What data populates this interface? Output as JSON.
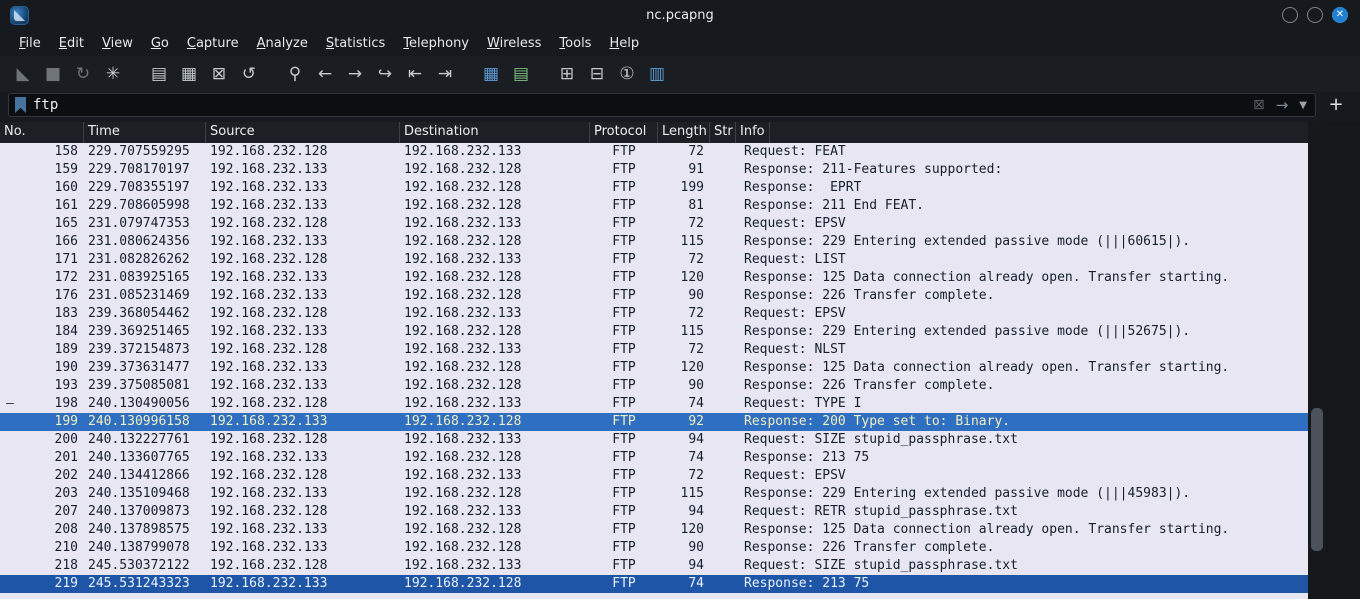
{
  "window": {
    "title": "nc.pcapng",
    "controls": [
      {
        "name": "minimize-button",
        "glyph": ""
      },
      {
        "name": "maximize-button",
        "glyph": ""
      },
      {
        "name": "close-button",
        "glyph": "✕",
        "state": "close"
      }
    ]
  },
  "menu": {
    "items": [
      "File",
      "Edit",
      "View",
      "Go",
      "Capture",
      "Analyze",
      "Statistics",
      "Telephony",
      "Wireless",
      "Tools",
      "Help"
    ]
  },
  "toolbar": {
    "icons": [
      {
        "name": "capture-start-icon",
        "glyph": "◣",
        "state": "disabled"
      },
      {
        "name": "capture-stop-icon",
        "glyph": "■",
        "state": "disabled"
      },
      {
        "name": "capture-restart-icon",
        "glyph": "↻",
        "state": "disabled"
      },
      {
        "name": "capture-options-icon",
        "glyph": "✳"
      },
      {
        "name": "file-open-icon",
        "glyph": "▤",
        "state": "gap"
      },
      {
        "name": "file-save-icon",
        "glyph": "▦"
      },
      {
        "name": "file-close-icon",
        "glyph": "⊠"
      },
      {
        "name": "reload-icon",
        "glyph": "↺"
      },
      {
        "name": "find-packet-icon",
        "glyph": "⚲",
        "state": "gap"
      },
      {
        "name": "go-back-icon",
        "glyph": "←"
      },
      {
        "name": "go-forward-icon",
        "glyph": "→"
      },
      {
        "name": "go-to-packet-icon",
        "glyph": "↪"
      },
      {
        "name": "go-first-packet-icon",
        "glyph": "⇤"
      },
      {
        "name": "go-last-packet-icon",
        "glyph": "⇥"
      },
      {
        "name": "colorize-icon",
        "glyph": "▦",
        "state": "blue gap"
      },
      {
        "name": "auto-scroll-icon",
        "glyph": "▤",
        "state": "green"
      },
      {
        "name": "zoom-in-icon",
        "glyph": "⊞",
        "state": "gap"
      },
      {
        "name": "zoom-out-icon",
        "glyph": "⊟"
      },
      {
        "name": "zoom-original-icon",
        "glyph": "①"
      },
      {
        "name": "resize-columns-icon",
        "glyph": "▥",
        "state": "blue"
      }
    ]
  },
  "filter": {
    "value": "ftp",
    "add_button": "+"
  },
  "table": {
    "columns": [
      "No.",
      "Time",
      "Source",
      "Destination",
      "Protocol",
      "Length",
      "Str",
      "Info"
    ],
    "rows": [
      {
        "no": "158",
        "time": "229.707559295",
        "src": "192.168.232.128",
        "dst": "192.168.232.133",
        "proto": "FTP",
        "len": "72",
        "info": "Request: FEAT"
      },
      {
        "no": "159",
        "time": "229.708170197",
        "src": "192.168.232.133",
        "dst": "192.168.232.128",
        "proto": "FTP",
        "len": "91",
        "info": "Response: 211-Features supported:"
      },
      {
        "no": "160",
        "time": "229.708355197",
        "src": "192.168.232.133",
        "dst": "192.168.232.128",
        "proto": "FTP",
        "len": "199",
        "info": "Response:  EPRT"
      },
      {
        "no": "161",
        "time": "229.708605998",
        "src": "192.168.232.133",
        "dst": "192.168.232.128",
        "proto": "FTP",
        "len": "81",
        "info": "Response: 211 End FEAT."
      },
      {
        "no": "165",
        "time": "231.079747353",
        "src": "192.168.232.128",
        "dst": "192.168.232.133",
        "proto": "FTP",
        "len": "72",
        "info": "Request: EPSV"
      },
      {
        "no": "166",
        "time": "231.080624356",
        "src": "192.168.232.133",
        "dst": "192.168.232.128",
        "proto": "FTP",
        "len": "115",
        "info": "Response: 229 Entering extended passive mode (|||60615|)."
      },
      {
        "no": "171",
        "time": "231.082826262",
        "src": "192.168.232.128",
        "dst": "192.168.232.133",
        "proto": "FTP",
        "len": "72",
        "info": "Request: LIST"
      },
      {
        "no": "172",
        "time": "231.083925165",
        "src": "192.168.232.133",
        "dst": "192.168.232.128",
        "proto": "FTP",
        "len": "120",
        "info": "Response: 125 Data connection already open. Transfer starting."
      },
      {
        "no": "176",
        "time": "231.085231469",
        "src": "192.168.232.133",
        "dst": "192.168.232.128",
        "proto": "FTP",
        "len": "90",
        "info": "Response: 226 Transfer complete."
      },
      {
        "no": "183",
        "time": "239.368054462",
        "src": "192.168.232.128",
        "dst": "192.168.232.133",
        "proto": "FTP",
        "len": "72",
        "info": "Request: EPSV"
      },
      {
        "no": "184",
        "time": "239.369251465",
        "src": "192.168.232.133",
        "dst": "192.168.232.128",
        "proto": "FTP",
        "len": "115",
        "info": "Response: 229 Entering extended passive mode (|||52675|)."
      },
      {
        "no": "189",
        "time": "239.372154873",
        "src": "192.168.232.128",
        "dst": "192.168.232.133",
        "proto": "FTP",
        "len": "72",
        "info": "Request: NLST"
      },
      {
        "no": "190",
        "time": "239.373631477",
        "src": "192.168.232.133",
        "dst": "192.168.232.128",
        "proto": "FTP",
        "len": "120",
        "info": "Response: 125 Data connection already open. Transfer starting."
      },
      {
        "no": "193",
        "time": "239.375085081",
        "src": "192.168.232.133",
        "dst": "192.168.232.128",
        "proto": "FTP",
        "len": "90",
        "info": "Response: 226 Transfer complete."
      },
      {
        "no": "198",
        "time": "240.130490056",
        "src": "192.168.232.128",
        "dst": "192.168.232.133",
        "proto": "FTP",
        "len": "74",
        "info": "Request: TYPE I",
        "marker": "–"
      },
      {
        "no": "199",
        "time": "240.130996158",
        "src": "192.168.232.133",
        "dst": "192.168.232.128",
        "proto": "FTP",
        "len": "92",
        "info": "Response: 200 Type set to: Binary.",
        "state": "selected"
      },
      {
        "no": "200",
        "time": "240.132227761",
        "src": "192.168.232.128",
        "dst": "192.168.232.133",
        "proto": "FTP",
        "len": "94",
        "info": "Request: SIZE stupid_passphrase.txt"
      },
      {
        "no": "201",
        "time": "240.133607765",
        "src": "192.168.232.133",
        "dst": "192.168.232.128",
        "proto": "FTP",
        "len": "74",
        "info": "Response: 213 75"
      },
      {
        "no": "202",
        "time": "240.134412866",
        "src": "192.168.232.128",
        "dst": "192.168.232.133",
        "proto": "FTP",
        "len": "72",
        "info": "Request: EPSV"
      },
      {
        "no": "203",
        "time": "240.135109468",
        "src": "192.168.232.133",
        "dst": "192.168.232.128",
        "proto": "FTP",
        "len": "115",
        "info": "Response: 229 Entering extended passive mode (|||45983|)."
      },
      {
        "no": "207",
        "time": "240.137009873",
        "src": "192.168.232.128",
        "dst": "192.168.232.133",
        "proto": "FTP",
        "len": "94",
        "info": "Request: RETR stupid_passphrase.txt"
      },
      {
        "no": "208",
        "time": "240.137898575",
        "src": "192.168.232.133",
        "dst": "192.168.232.128",
        "proto": "FTP",
        "len": "120",
        "info": "Response: 125 Data connection already open. Transfer starting."
      },
      {
        "no": "210",
        "time": "240.138799078",
        "src": "192.168.232.133",
        "dst": "192.168.232.128",
        "proto": "FTP",
        "len": "90",
        "info": "Response: 226 Transfer complete."
      },
      {
        "no": "218",
        "time": "245.530372122",
        "src": "192.168.232.128",
        "dst": "192.168.232.133",
        "proto": "FTP",
        "len": "94",
        "info": "Request: SIZE stupid_passphrase.txt"
      },
      {
        "no": "219",
        "time": "245.531243323",
        "src": "192.168.232.133",
        "dst": "192.168.232.128",
        "proto": "FTP",
        "len": "74",
        "info": "Response: 213 75",
        "state": "selected-dark"
      }
    ]
  },
  "colors": {
    "chrome_bg": "#16191d",
    "row_bg": "#e7e6f2",
    "selected_row_bg": "#2e6fc1",
    "selected_row_text": "#f2eec0",
    "selected_row_dark_bg": "#1e55a6",
    "close_button_bg": "#1f7fd0",
    "header_bg": "#1c2024"
  }
}
